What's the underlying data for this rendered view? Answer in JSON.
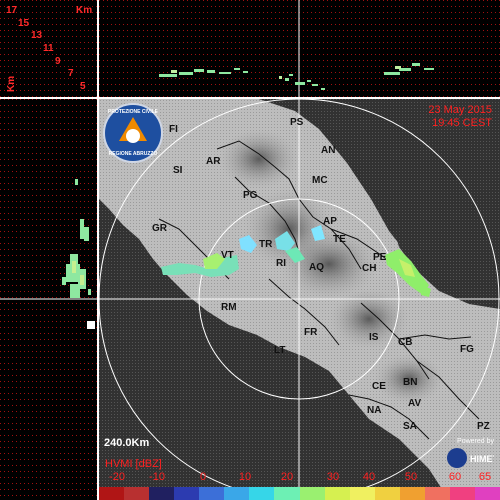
{
  "corner": {
    "km_unit": "Km",
    "km_values": [
      "17",
      "15",
      "13",
      "11",
      "9",
      "7",
      "5"
    ],
    "axis_label": "Km"
  },
  "map": {
    "date_line": "23 May 2015",
    "time_line": "19:45 CEST",
    "scale_label": "240.0Km",
    "legend_title": "HVMI [dBZ]",
    "legend_values": [
      "-20",
      "-10",
      "0",
      "10",
      "20",
      "30",
      "40",
      "50",
      "60",
      "65"
    ],
    "legend_colors": [
      "#b01515",
      "#b83030",
      "#202060",
      "#2c3bb0",
      "#3c6fd8",
      "#3aa7e8",
      "#36d6e8",
      "#6df0b4",
      "#9af070",
      "#d6f050",
      "#f0f060",
      "#f0d040",
      "#f0a030",
      "#f07060",
      "#f04080",
      "#e040c0"
    ],
    "powered_by": "Powered by",
    "himet_logo": "HIMET",
    "logo_text_top": "PROTEZIONE CIVILE",
    "logo_text_bottom": "REGIONE ABRUZZO",
    "cities": [
      {
        "id": "ps",
        "name": "PS"
      },
      {
        "id": "an",
        "name": "AN"
      },
      {
        "id": "fi",
        "name": "FI"
      },
      {
        "id": "ar",
        "name": "AR"
      },
      {
        "id": "si",
        "name": "SI"
      },
      {
        "id": "mc",
        "name": "MC"
      },
      {
        "id": "pg",
        "name": "PG"
      },
      {
        "id": "ap",
        "name": "AP"
      },
      {
        "id": "gr",
        "name": "GR"
      },
      {
        "id": "te",
        "name": "TE"
      },
      {
        "id": "tr",
        "name": "TR"
      },
      {
        "id": "pe",
        "name": "PE"
      },
      {
        "id": "vt",
        "name": "VT"
      },
      {
        "id": "ri",
        "name": "RI"
      },
      {
        "id": "aq",
        "name": "AQ"
      },
      {
        "id": "ch",
        "name": "CH"
      },
      {
        "id": "rm",
        "name": "RM"
      },
      {
        "id": "fr",
        "name": "FR"
      },
      {
        "id": "is",
        "name": "IS"
      },
      {
        "id": "cb",
        "name": "CB"
      },
      {
        "id": "fg",
        "name": "FG"
      },
      {
        "id": "lt",
        "name": "LT"
      },
      {
        "id": "ce",
        "name": "CE"
      },
      {
        "id": "bn",
        "name": "BN"
      },
      {
        "id": "na",
        "name": "NA"
      },
      {
        "id": "av",
        "name": "AV"
      },
      {
        "id": "sa",
        "name": "SA"
      },
      {
        "id": "pz",
        "name": "PZ"
      }
    ]
  }
}
